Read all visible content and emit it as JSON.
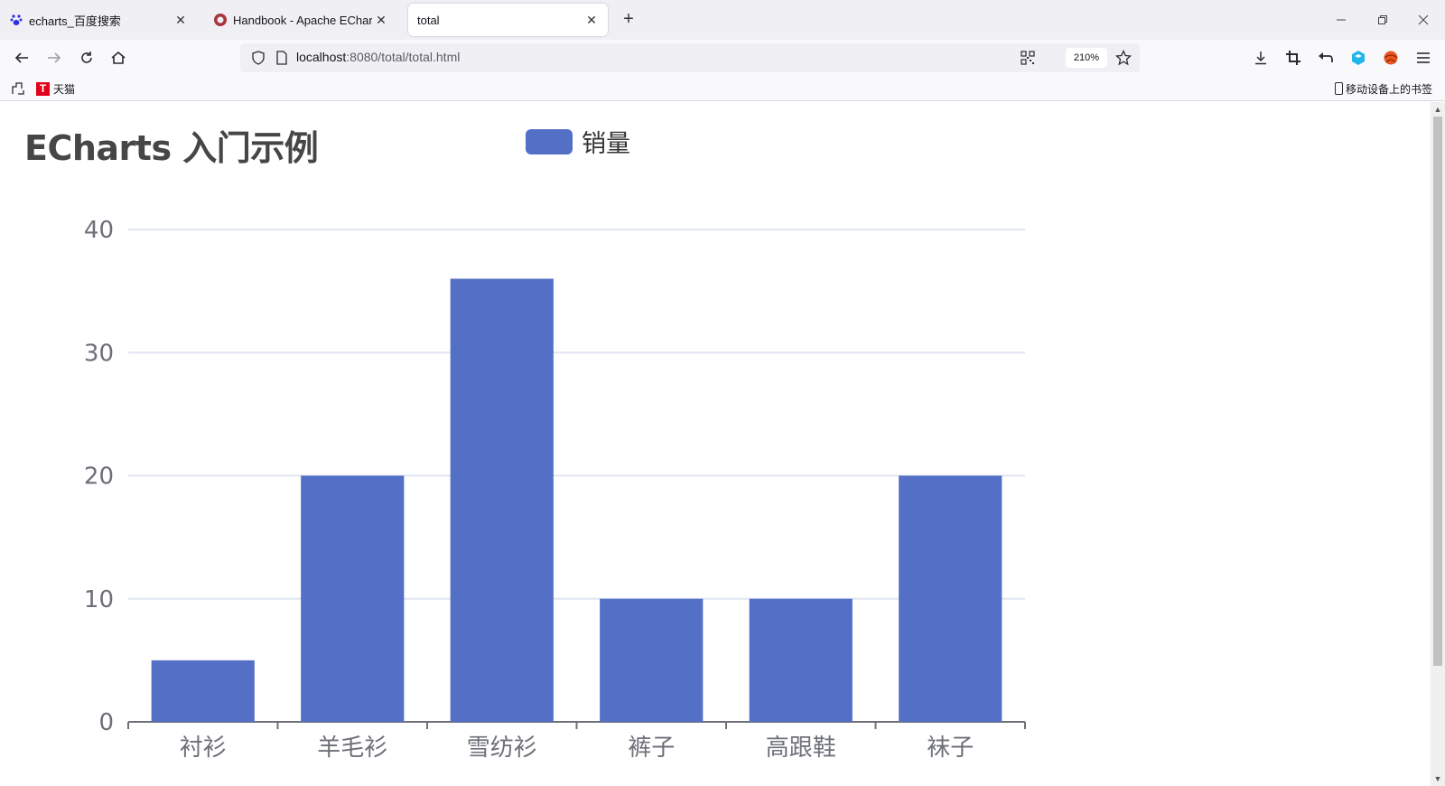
{
  "browser": {
    "tabs": [
      {
        "title": "echarts_百度搜索",
        "icon": "baidu-paw-icon",
        "active": false
      },
      {
        "title": "Handbook - Apache ECharts",
        "icon": "echarts-logo-icon",
        "active": false
      },
      {
        "title": "total",
        "icon": "",
        "active": true
      }
    ],
    "url_host": "localhost",
    "url_path": ":8080/total/total.html",
    "zoom": "210%",
    "bookmarks": [
      {
        "label": "天猫",
        "icon": "tmall-icon"
      }
    ],
    "mobile_bookmarks": "移动设备上的书签"
  },
  "page": {
    "title": "ECharts 入门示例",
    "legend": "销量"
  },
  "chart_data": {
    "type": "bar",
    "title": "ECharts 入门示例",
    "categories": [
      "衬衫",
      "羊毛衫",
      "雪纺衫",
      "裤子",
      "高跟鞋",
      "袜子"
    ],
    "series": [
      {
        "name": "销量",
        "values": [
          5,
          20,
          36,
          10,
          10,
          20
        ],
        "color": "#5470c6"
      }
    ],
    "ylim": [
      0,
      40
    ],
    "yticks": [
      0,
      10,
      20,
      30,
      40
    ],
    "grid": true,
    "legend_position": "top-center"
  }
}
